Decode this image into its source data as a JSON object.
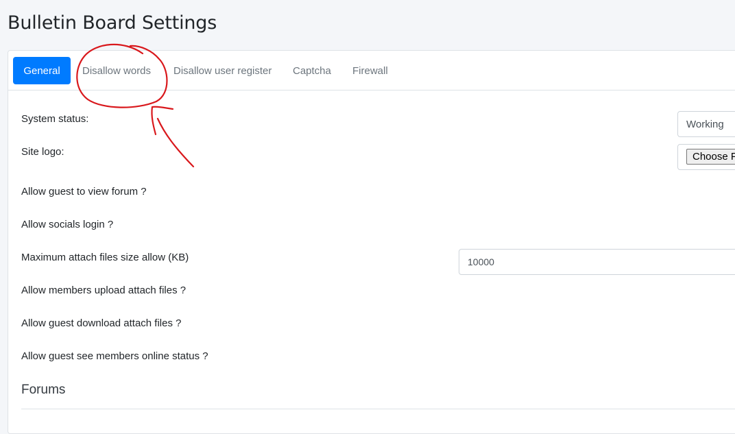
{
  "page": {
    "title": "Bulletin Board Settings"
  },
  "tabs": [
    {
      "label": "General",
      "active": true
    },
    {
      "label": "Disallow words",
      "active": false
    },
    {
      "label": "Disallow user register",
      "active": false
    },
    {
      "label": "Captcha",
      "active": false
    },
    {
      "label": "Firewall",
      "active": false
    }
  ],
  "settings": {
    "system_status": {
      "label": "System status:",
      "value": "Working"
    },
    "site_logo": {
      "label": "Site logo:",
      "button": "Choose File"
    },
    "allow_guest_view": {
      "label": "Allow guest to view forum ?"
    },
    "allow_social_login": {
      "label": "Allow socials login ?"
    },
    "max_attach_size": {
      "label": "Maximum attach files size allow (KB)",
      "value": "10000"
    },
    "allow_member_upload": {
      "label": "Allow members upload attach files ?"
    },
    "allow_guest_download": {
      "label": "Allow guest download attach files ?"
    },
    "allow_guest_online_status": {
      "label": "Allow guest see members online status ?"
    }
  },
  "forums_section": {
    "title": "Forums"
  },
  "colors": {
    "accent": "#007bff",
    "annotation": "#d9181c",
    "page_background": "#f4f6f9"
  }
}
